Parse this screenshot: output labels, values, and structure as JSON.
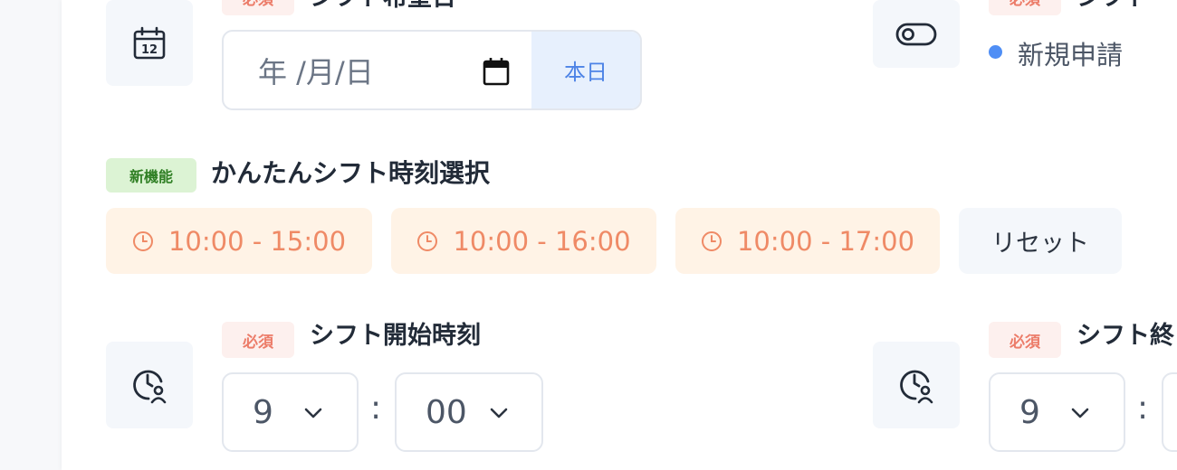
{
  "start_date": {
    "required_label": "必須",
    "title": "シフト希望日",
    "date_placeholder": "年 /月/日",
    "today_button": "本日"
  },
  "shift_type": {
    "required_label": "必須",
    "title": "シフト",
    "status_text": "新規申請",
    "status_color": "#4f8ef5"
  },
  "quick_select": {
    "new_badge": "新機能",
    "title": "かんたんシフト時刻選択",
    "presets": [
      {
        "label": "10:00 - 15:00"
      },
      {
        "label": "10:00 - 16:00"
      },
      {
        "label": "10:00 - 17:00"
      }
    ],
    "reset_label": "リセット"
  },
  "start_time": {
    "required_label": "必須",
    "title": "シフト開始時刻",
    "hour": "9",
    "minute": "00",
    "separator": ":"
  },
  "end_time": {
    "required_label": "必須",
    "title": "シフト終",
    "hour": "9",
    "separator": ":"
  },
  "colors": {
    "accent_blue": "#4d83e6",
    "required": "#ec7c69",
    "preset": "#ef8a66",
    "new_feature": "#2f7f24"
  },
  "icons": [
    "calendar-icon",
    "toggle-icon",
    "clock-icon",
    "clock-user-icon",
    "chevron-down-icon"
  ]
}
